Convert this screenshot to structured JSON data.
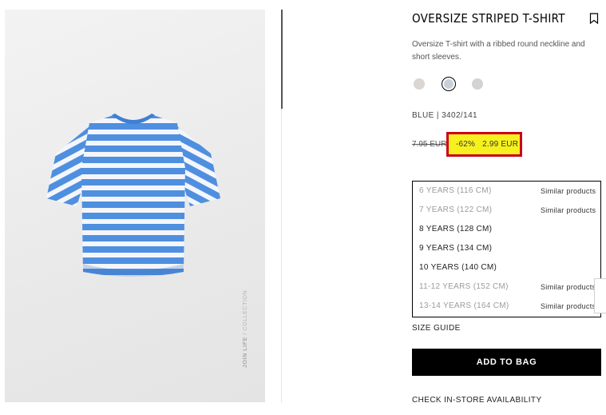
{
  "product": {
    "title": "OVERSIZE STRIPED T-SHIRT",
    "description": "Oversize T-shirt with a ribbed round neckline and short sleeves.",
    "image_alt": "Blue and white striped oversize T-shirt",
    "watermark_bold": "JOIN LIFE",
    "watermark_rest": " / COLLECTION",
    "colors": [
      {
        "name": "beige",
        "hex": "#d9d6d3",
        "selected": false
      },
      {
        "name": "blue",
        "hex": "#c9d0d8",
        "selected": true
      },
      {
        "name": "grey",
        "hex": "#d3d3d3",
        "selected": false
      }
    ],
    "color_ref": "BLUE | 3402/141",
    "price": {
      "old": "7.95 EUR",
      "discount": "-62%",
      "new": "2.99 EUR",
      "highlight_fill": "#f6f11e",
      "highlight_border": "#c9001a"
    },
    "sizes": [
      {
        "label": "6 YEARS (116 CM)",
        "available": false,
        "similar": "Similar products"
      },
      {
        "label": "7 YEARS (122 CM)",
        "available": false,
        "similar": "Similar products"
      },
      {
        "label": "8 YEARS (128 CM)",
        "available": true,
        "similar": ""
      },
      {
        "label": "9 YEARS (134 CM)",
        "available": true,
        "similar": ""
      },
      {
        "label": "10 YEARS (140 CM)",
        "available": true,
        "similar": ""
      },
      {
        "label": "11-12 YEARS (152 CM)",
        "available": false,
        "similar": "Similar products"
      },
      {
        "label": "13-14 YEARS (164 CM)",
        "available": false,
        "similar": "Similar products"
      }
    ],
    "size_guide": "SIZE GUIDE",
    "add_to_bag": "ADD TO BAG",
    "store_availability": "CHECK IN-STORE AVAILABILITY"
  },
  "icons": {
    "bookmark": "bookmark-icon"
  },
  "colors": {
    "tshirt_blue": "#4f8fe0",
    "tshirt_stripe": "#f4f6fb",
    "button_bg": "#000000"
  }
}
